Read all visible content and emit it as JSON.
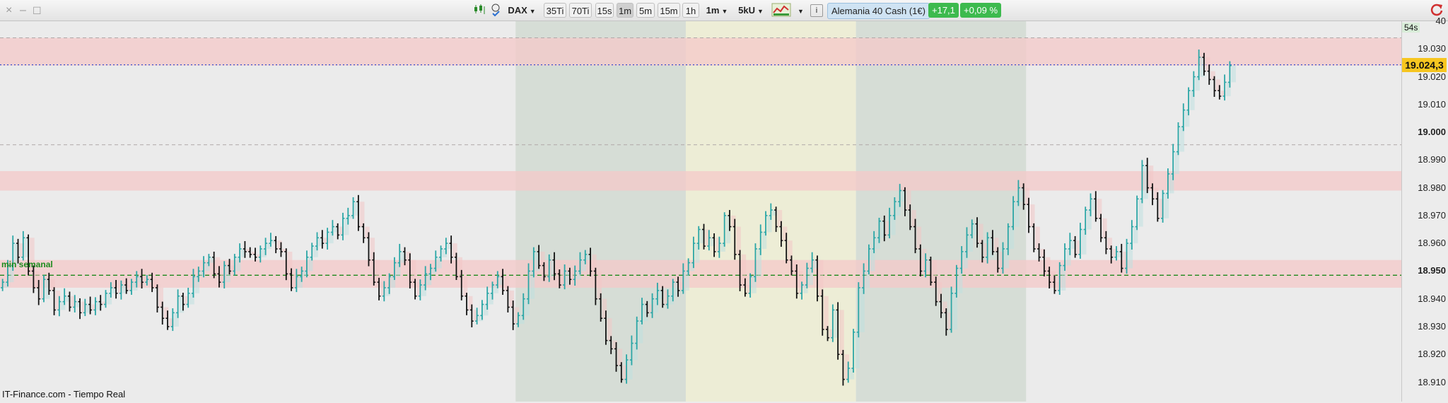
{
  "toolbar": {
    "window_controls": [
      "×",
      "–",
      "☐"
    ],
    "symbol": "DAX",
    "tick_buttons": [
      "35Ti",
      "70Ti"
    ],
    "time_buttons": [
      "15s",
      "1m",
      "5m",
      "15m",
      "1h"
    ],
    "active_time": "1m",
    "interval": "1m",
    "volume_unit": "5kU",
    "info_icon": "info-icon",
    "instrument": "Alemania 40 Cash (1€)",
    "change_points": "+17,1",
    "change_percent": "+0,09 %",
    "colors": {
      "instrument_bg": "#cfe3f3",
      "positive": "#3dba4e"
    }
  },
  "chart_data": {
    "type": "candlestick",
    "title": "",
    "xlabel": "",
    "ylabel": "",
    "ylim": [
      18903,
      19040
    ],
    "y_ticks": [
      18910,
      18920,
      18930,
      18940,
      18950,
      18960,
      18970,
      18980,
      18990,
      19000,
      19010,
      19020,
      19030,
      19040
    ],
    "y_major_ticks": [
      18950,
      19000
    ],
    "y_tick_labels": [
      "18.910",
      "18.920",
      "18.930",
      "18.940",
      "18.950",
      "18.960",
      "18.970",
      "18.980",
      "18.990",
      "19.000",
      "19.010",
      "19.020",
      "19.030",
      "40"
    ],
    "last_price": 19024.3,
    "last_price_label": "19.024,3",
    "timer": "54s",
    "level_line": {
      "value": 18948.5,
      "label": "min semanal",
      "color": "#1c8a1c"
    },
    "resistance_zones": [
      [
        19024,
        19034
      ],
      [
        18979,
        18986
      ],
      [
        18944,
        18954
      ]
    ],
    "dashed_lines": [
      19034,
      18995.5
    ],
    "dotted_line": 19024.3,
    "session_shading": [
      {
        "from_bar": 0,
        "to_bar": 100,
        "color": "#ebebeb"
      },
      {
        "from_bar": 100,
        "to_bar": 133,
        "color": "#d6ddd6"
      },
      {
        "from_bar": 133,
        "to_bar": 166,
        "color": "#ededd6"
      },
      {
        "from_bar": 166,
        "to_bar": 199,
        "color": "#d6ddd6"
      },
      {
        "from_bar": 199,
        "to_bar": 232,
        "color": "#ebebeb"
      }
    ],
    "bar_count": 232,
    "colors": {
      "up": "#2aa6a6",
      "down": "#111111",
      "zone": "#f4c8c8"
    },
    "closes": [
      18946,
      18952,
      18960,
      18955,
      18962,
      18950,
      18944,
      18940,
      18947,
      18943,
      18936,
      18939,
      18941,
      18937,
      18939,
      18935,
      18938,
      18936,
      18939,
      18938,
      18942,
      18944,
      18942,
      18945,
      18943,
      18946,
      18948,
      18946,
      18947,
      18944,
      18937,
      18933,
      18930,
      18935,
      18941,
      18938,
      18942,
      18948,
      18950,
      18953,
      18955,
      18949,
      18946,
      18952,
      18950,
      18955,
      18958,
      18957,
      18956,
      18955,
      18958,
      18960,
      18961,
      18958,
      18957,
      18949,
      18944,
      18948,
      18950,
      18955,
      18959,
      18962,
      18960,
      18964,
      18966,
      18963,
      18969,
      18970,
      18975,
      18966,
      18962,
      18954,
      18946,
      18941,
      18944,
      18948,
      18953,
      18957,
      18954,
      18946,
      18941,
      18945,
      18949,
      18951,
      18955,
      18958,
      18960,
      18955,
      18948,
      18941,
      18936,
      18932,
      18934,
      18938,
      18942,
      18945,
      18948,
      18943,
      18937,
      18931,
      18934,
      18940,
      18950,
      18957,
      18952,
      18948,
      18954,
      18949,
      18945,
      18950,
      18947,
      18950,
      18954,
      18956,
      18950,
      18940,
      18933,
      18925,
      18922,
      18916,
      18911,
      18918,
      18924,
      18932,
      18938,
      18935,
      18940,
      18943,
      18938,
      18941,
      18946,
      18943,
      18950,
      18953,
      18960,
      18965,
      18959,
      18962,
      18957,
      18960,
      18970,
      18966,
      18956,
      18945,
      18942,
      18948,
      18958,
      18964,
      18970,
      18972,
      18966,
      18961,
      18954,
      18950,
      18942,
      18945,
      18951,
      18954,
      18941,
      18929,
      18926,
      18936,
      18920,
      18911,
      18915,
      18928,
      18944,
      18950,
      18958,
      18962,
      18968,
      18963,
      18970,
      18975,
      18979,
      18972,
      18966,
      18958,
      18950,
      18954,
      18946,
      18939,
      18935,
      18929,
      18942,
      18951,
      18957,
      18963,
      18967,
      18960,
      18955,
      18962,
      18957,
      18951,
      18958,
      18966,
      18975,
      18980,
      18974,
      18966,
      18958,
      18955,
      18950,
      18946,
      18943,
      18952,
      18958,
      18961,
      18956,
      18965,
      18972,
      18976,
      18969,
      18962,
      18958,
      18955,
      18957,
      18951,
      18960,
      18966,
      18976,
      18988,
      18980,
      18976,
      18969,
      18978,
      18985,
      18993,
      19002,
      19008,
      19015,
      19020,
      19027,
      19022,
      19019,
      19015,
      19013,
      19018,
      19024
    ]
  },
  "footer": {
    "source": "IT-Finance.com - Tiempo Real"
  }
}
